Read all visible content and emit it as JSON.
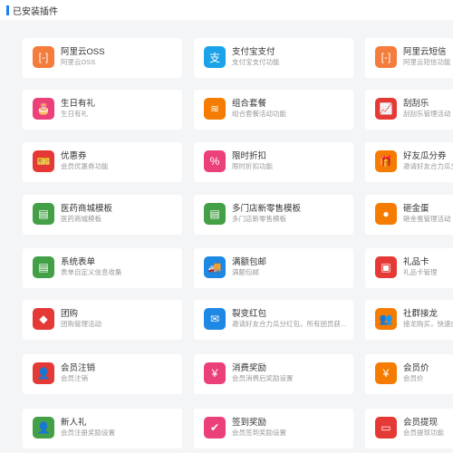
{
  "section_title": "已安装插件",
  "plugins": [
    {
      "name": "阿里云OSS",
      "desc": "阿里云OSS",
      "color": "#f47c3c",
      "icon": "bracket-icon"
    },
    {
      "name": "支付宝支付",
      "desc": "支付宝支付功能",
      "color": "#1aa3e8",
      "icon": "alipay-icon"
    },
    {
      "name": "阿里云短信",
      "desc": "阿里云短信功能",
      "color": "#f47c3c",
      "icon": "bracket-icon"
    },
    {
      "name": "生日有礼",
      "desc": "生日有礼",
      "color": "#ec407a",
      "icon": "cake-icon"
    },
    {
      "name": "组合套餐",
      "desc": "组合套餐活动功能",
      "color": "#f57c00",
      "icon": "layers-icon"
    },
    {
      "name": "刮刮乐",
      "desc": "刮刮乐管理活动",
      "color": "#e53935",
      "icon": "chart-icon"
    },
    {
      "name": "优惠券",
      "desc": "会员优惠券功能",
      "color": "#e53935",
      "icon": "coupon-icon"
    },
    {
      "name": "限时折扣",
      "desc": "限时折扣功能",
      "color": "#ec407a",
      "icon": "percent-icon"
    },
    {
      "name": "好友瓜分券",
      "desc": "邀请好友合力瓜分券",
      "color": "#f57c00",
      "icon": "gift-bag-icon"
    },
    {
      "name": "医药商城模板",
      "desc": "医药商城模板",
      "color": "#43a047",
      "icon": "document-icon"
    },
    {
      "name": "多门店新零售模板",
      "desc": "多门店新零售模板",
      "color": "#43a047",
      "icon": "document-icon"
    },
    {
      "name": "砸金蛋",
      "desc": "砸金蛋管理活动",
      "color": "#f57c00",
      "icon": "egg-icon"
    },
    {
      "name": "系统表单",
      "desc": "表单自定义信息收集",
      "color": "#43a047",
      "icon": "document-icon"
    },
    {
      "name": "满额包邮",
      "desc": "满额包邮",
      "color": "#1e88e5",
      "icon": "truck-icon"
    },
    {
      "name": "礼品卡",
      "desc": "礼品卡管理",
      "color": "#e53935",
      "icon": "gift-card-icon"
    },
    {
      "name": "团购",
      "desc": "团购管理活动",
      "color": "#e53935",
      "icon": "tag-icon"
    },
    {
      "name": "裂变红包",
      "desc": "邀请好友合力瓜分红包，所有团员获...",
      "color": "#1e88e5",
      "icon": "red-packet-icon"
    },
    {
      "name": "社群接龙",
      "desc": "接龙购买，快速成团",
      "color": "#f57c00",
      "icon": "group-icon"
    },
    {
      "name": "会员注销",
      "desc": "会员注销",
      "color": "#e53935",
      "icon": "user-remove-icon"
    },
    {
      "name": "消费奖励",
      "desc": "会员消费后奖励设置",
      "color": "#ec407a",
      "icon": "money-bag-icon"
    },
    {
      "name": "会员价",
      "desc": "会员价",
      "color": "#f57c00",
      "icon": "price-icon"
    },
    {
      "name": "新人礼",
      "desc": "会员注册奖励设置",
      "color": "#43a047",
      "icon": "user-gift-icon"
    },
    {
      "name": "签到奖励",
      "desc": "会员签到奖励设置",
      "color": "#ec407a",
      "icon": "calendar-check-icon"
    },
    {
      "name": "会员提现",
      "desc": "会员提现功能",
      "color": "#e53935",
      "icon": "wallet-icon"
    }
  ]
}
